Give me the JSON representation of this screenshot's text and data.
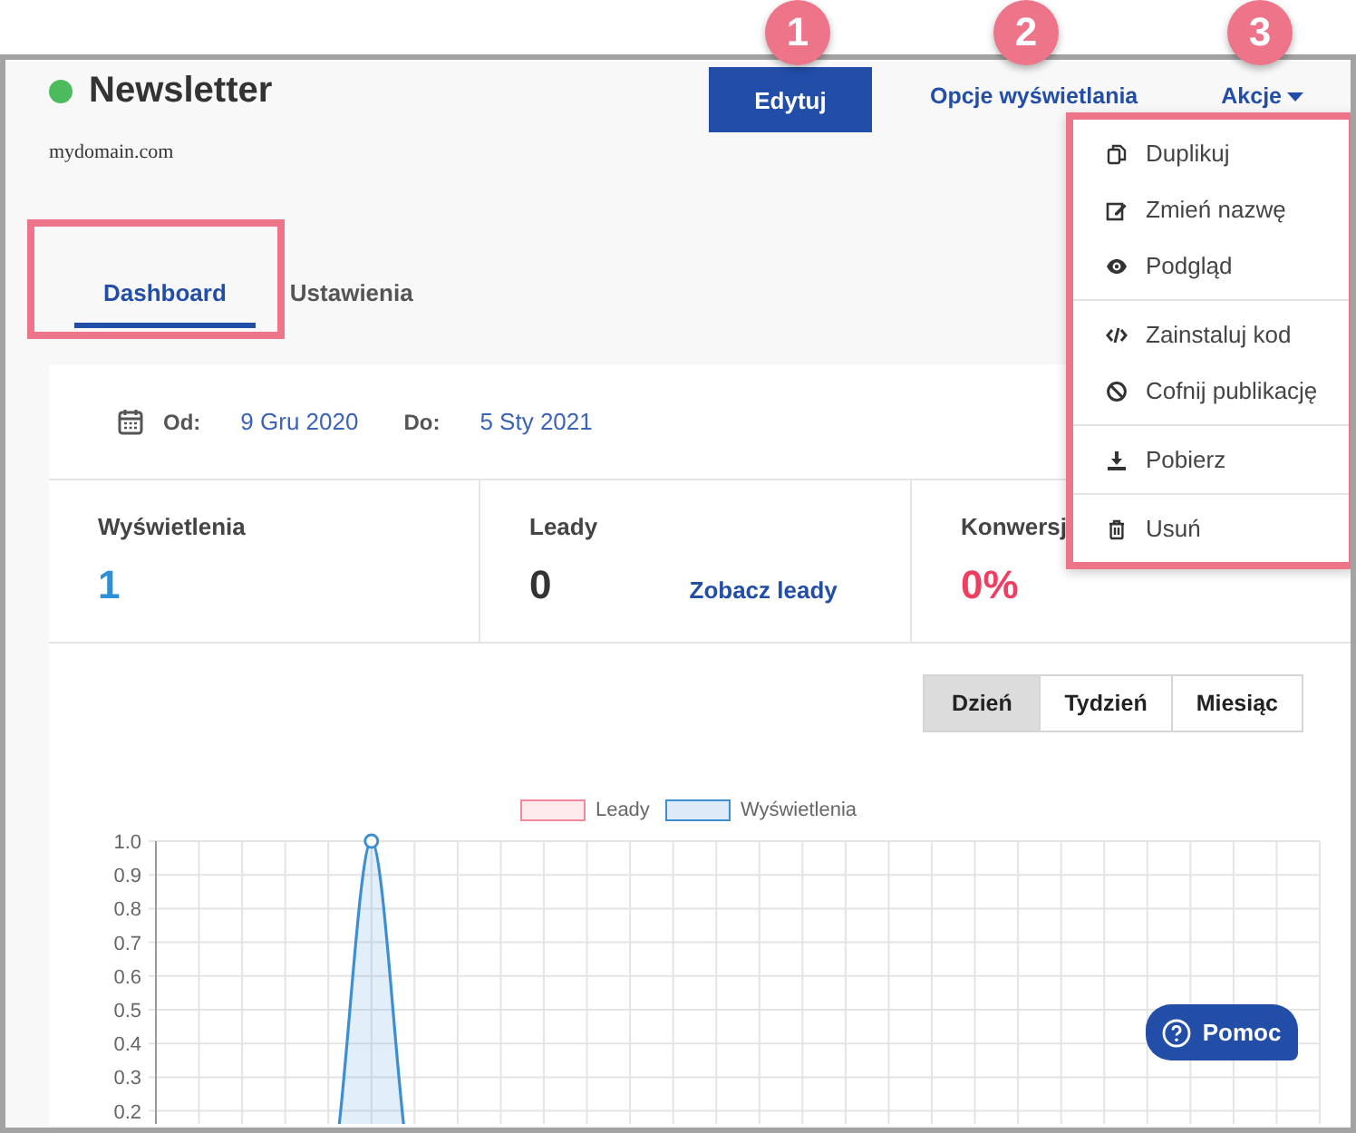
{
  "callouts": [
    "1",
    "2",
    "3"
  ],
  "header": {
    "title": "Newsletter",
    "published": true,
    "domain": "mydomain.com",
    "edit_button": "Edytuj",
    "display_options": "Opcje wyświetlania"
  },
  "actions_menu": {
    "label": "Akcje",
    "expanded": true,
    "groups": [
      [
        {
          "kind": "duplicate",
          "label": "Duplikuj"
        },
        {
          "kind": "rename",
          "label": "Zmień nazwę"
        },
        {
          "kind": "preview",
          "label": "Podgląd"
        }
      ],
      [
        {
          "kind": "code",
          "label": "Zainstaluj kod"
        },
        {
          "kind": "unpublish",
          "label": "Cofnij publikację"
        }
      ],
      [
        {
          "kind": "download",
          "label": "Pobierz"
        }
      ],
      [
        {
          "kind": "delete",
          "label": "Usuń"
        }
      ]
    ]
  },
  "tabs": [
    {
      "label": "Dashboard",
      "selected": true
    },
    {
      "label": "Ustawienia",
      "selected": false
    }
  ],
  "date_range": {
    "from_label": "Od:",
    "from": "9 Gru 2020",
    "to_label": "Do:",
    "to": "5 Sty 2021"
  },
  "stats": [
    {
      "label": "Wyświetlenia",
      "value": "1",
      "kind": "views"
    },
    {
      "label": "Leady",
      "value": "0",
      "kind": "leads",
      "link": "Zobacz leady"
    },
    {
      "label": "Konwersj",
      "value": "0%",
      "kind": "conversion"
    }
  ],
  "range_buttons": [
    {
      "label": "Dzień",
      "selected": true
    },
    {
      "label": "Tydzień",
      "selected": false
    },
    {
      "label": "Miesiąc",
      "selected": false
    }
  ],
  "chart": {
    "chart_data": {
      "type": "area",
      "grid": true,
      "ylim": [
        0,
        1
      ],
      "yticks": [
        {
          "value": 1,
          "label": "1.0"
        },
        0.9,
        0.8,
        0.7,
        0.6,
        0.5,
        0.4,
        0.3,
        0.2
      ],
      "series": [
        {
          "name": "Leady",
          "color": "#f08a9a",
          "values": [
            null,
            null,
            null,
            null,
            null,
            null,
            null,
            null,
            null,
            null,
            null,
            null,
            null,
            null,
            null,
            null,
            null,
            null,
            null,
            null,
            null,
            null,
            null,
            null,
            null,
            null,
            null,
            null
          ]
        },
        {
          "name": "Wyświetlenia",
          "color": "#3d8fd1",
          "values": [
            null,
            null,
            null,
            null,
            0,
            1,
            0,
            null,
            null,
            null,
            null,
            null,
            null,
            null,
            null,
            null,
            null,
            null,
            null,
            null,
            null,
            null,
            null,
            null,
            null,
            null,
            null,
            null
          ]
        }
      ]
    }
  },
  "help_button": "Pomoc"
}
